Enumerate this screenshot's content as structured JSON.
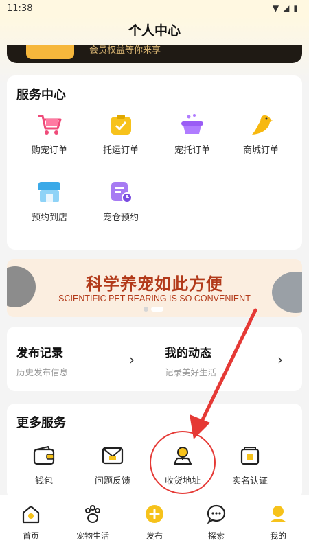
{
  "status_bar": {
    "time": "11:38"
  },
  "header": {
    "title": "个人中心"
  },
  "vip_banner": {
    "text": "会员权益等你来享"
  },
  "service_center": {
    "title": "服务中心",
    "items": [
      {
        "label": "购宠订单",
        "icon": "shopping-cart-icon"
      },
      {
        "label": "托运订单",
        "icon": "clipboard-check-icon"
      },
      {
        "label": "宠托订单",
        "icon": "pet-bath-icon"
      },
      {
        "label": "商城订单",
        "icon": "bird-icon"
      },
      {
        "label": "预约到店",
        "icon": "store-icon"
      },
      {
        "label": "宠仓预约",
        "icon": "calendar-clock-icon"
      }
    ]
  },
  "promo_banner": {
    "title_cn": "科学养宠如此方便",
    "title_en": "SCIENTIFIC PET REARING IS SO CONVENIENT"
  },
  "records": {
    "left": {
      "title": "发布记录",
      "subtitle": "历史发布信息"
    },
    "right": {
      "title": "我的动态",
      "subtitle": "记录美好生活"
    }
  },
  "more_services": {
    "title": "更多服务",
    "items": [
      {
        "label": "钱包",
        "icon": "wallet-icon"
      },
      {
        "label": "问题反馈",
        "icon": "feedback-icon"
      },
      {
        "label": "收货地址",
        "icon": "address-pin-icon"
      },
      {
        "label": "实名认证",
        "icon": "verify-id-icon"
      }
    ]
  },
  "tabbar": {
    "items": [
      {
        "label": "首页",
        "icon": "home-icon"
      },
      {
        "label": "宠物生活",
        "icon": "paw-icon"
      },
      {
        "label": "发布",
        "icon": "plus-circle-icon"
      },
      {
        "label": "探索",
        "icon": "chat-bubble-icon"
      },
      {
        "label": "我的",
        "icon": "profile-icon"
      }
    ],
    "active_index": 4
  },
  "colors": {
    "accent": "#f6c21b",
    "banner_text": "#b23a1a",
    "annotation": "#e53935"
  }
}
